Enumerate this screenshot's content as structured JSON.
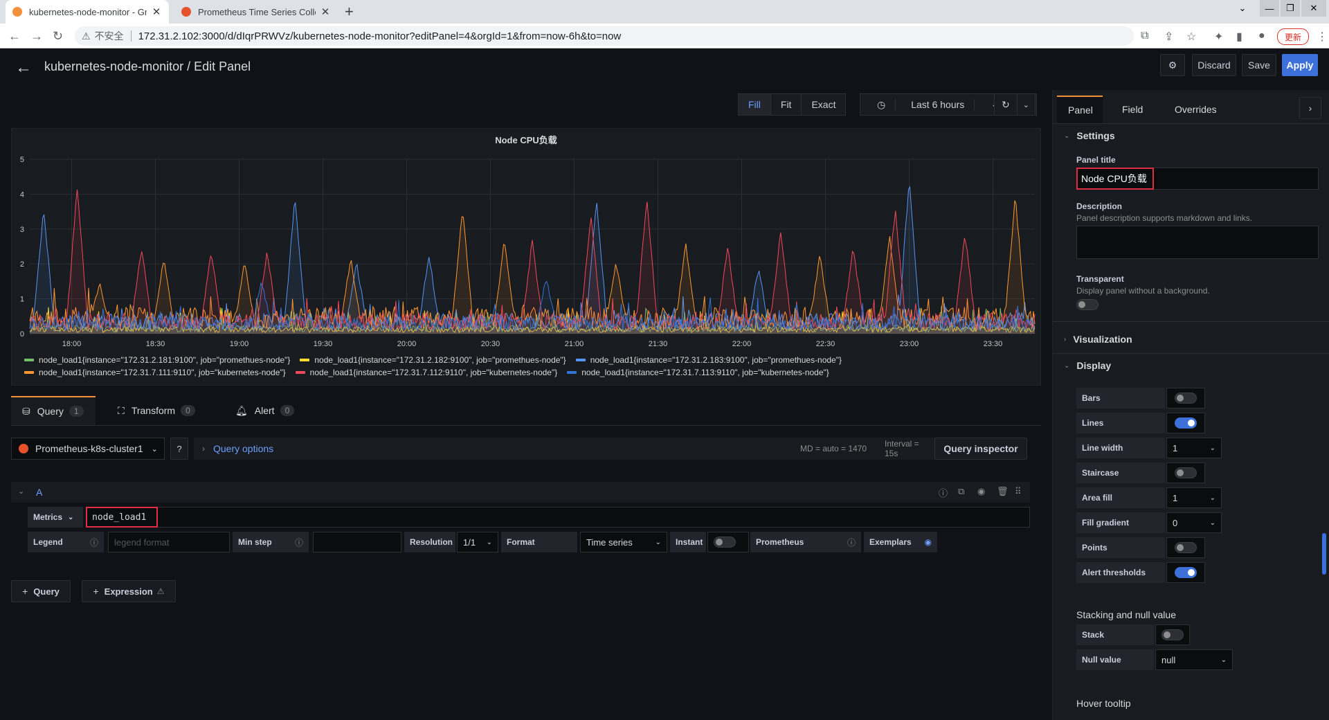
{
  "browser": {
    "tabs": [
      {
        "title": "kubernetes-node-monitor - Gr",
        "active": true
      },
      {
        "title": "Prometheus Time Series Colle",
        "active": false
      }
    ],
    "security_label": "不安全",
    "url": "172.31.2.102:3000/d/dIqrPRWVz/kubernetes-node-monitor?editPanel=4&orgId=1&from=now-6h&to=now",
    "update_label": "更新"
  },
  "header": {
    "title": "kubernetes-node-monitor / Edit Panel",
    "discard": "Discard",
    "save": "Save",
    "apply": "Apply"
  },
  "toolbar": {
    "fill": "Fill",
    "fit": "Fit",
    "exact": "Exact",
    "time_range": "Last 6 hours"
  },
  "panel": {
    "title": "Node CPU负载"
  },
  "chart_data": {
    "type": "line",
    "title": "Node CPU负载",
    "ylim": [
      0,
      5
    ],
    "yticks": [
      "0",
      "1",
      "2",
      "3",
      "4",
      "5"
    ],
    "xticks": [
      "18:00",
      "18:30",
      "19:00",
      "19:30",
      "20:00",
      "20:30",
      "21:00",
      "21:30",
      "22:00",
      "22:30",
      "23:00",
      "23:30"
    ],
    "series": [
      {
        "name": "node_load1{instance=\"172.31.2.181:9100\", job=\"promethues-node\"}",
        "color": "#73bf69",
        "base": 0.15,
        "peaks": []
      },
      {
        "name": "node_load1{instance=\"172.31.2.182:9100\", job=\"promethues-node\"}",
        "color": "#fade2a",
        "base": 0.12,
        "peaks": []
      },
      {
        "name": "node_load1{instance=\"172.31.2.183:9100\", job=\"promethues-node\"}",
        "color": "#5794f2",
        "base": 0.35,
        "peaks": [
          [
            "17:50",
            3.5
          ],
          [
            "19:20",
            3.85
          ],
          [
            "19:42",
            2.0
          ],
          [
            "20:08",
            2.2
          ],
          [
            "21:08",
            3.75
          ],
          [
            "22:06",
            1.8
          ],
          [
            "23:00",
            4.35
          ]
        ]
      },
      {
        "name": "node_load1{instance=\"172.31.7.111:9110\", job=\"kubernetes-node\"}",
        "color": "#ff9830",
        "base": 0.45,
        "peaks": [
          [
            "18:10",
            1.4
          ],
          [
            "18:33",
            2.1
          ],
          [
            "19:02",
            2.0
          ],
          [
            "19:40",
            2.1
          ],
          [
            "20:20",
            3.5
          ],
          [
            "20:35",
            2.6
          ],
          [
            "21:15",
            2.0
          ],
          [
            "21:40",
            2.5
          ],
          [
            "22:28",
            2.2
          ],
          [
            "22:53",
            2.7
          ],
          [
            "23:38",
            3.9
          ]
        ]
      },
      {
        "name": "node_load1{instance=\"172.31.7.112:9110\", job=\"kubernetes-node\"}",
        "color": "#f2495c",
        "base": 0.35,
        "peaks": [
          [
            "18:02",
            4.15
          ],
          [
            "18:25",
            2.4
          ],
          [
            "18:50",
            2.3
          ],
          [
            "19:10",
            2.3
          ],
          [
            "20:45",
            2.6
          ],
          [
            "21:06",
            3.3
          ],
          [
            "21:26",
            3.85
          ],
          [
            "21:55",
            2.4
          ],
          [
            "22:14",
            2.9
          ],
          [
            "22:40",
            2.4
          ],
          [
            "22:55",
            3.5
          ],
          [
            "23:20",
            2.8
          ]
        ]
      },
      {
        "name": "node_load1{instance=\"172.31.7.113:9110\", job=\"kubernetes-node\"}",
        "color": "#3274d9",
        "base": 0.3,
        "peaks": [
          [
            "19:08",
            1.4
          ],
          [
            "20:50",
            1.5
          ]
        ]
      }
    ]
  },
  "query_tabs": [
    {
      "label": "Query",
      "count": "1"
    },
    {
      "label": "Transform",
      "count": "0"
    },
    {
      "label": "Alert",
      "count": "0"
    }
  ],
  "query": {
    "datasource": "Prometheus-k8s-cluster1",
    "options_label": "Query options",
    "md_info": "MD = auto = 1470",
    "interval_info": "Interval = 15s",
    "inspector": "Query inspector",
    "ref_id": "A",
    "metrics_label": "Metrics",
    "metrics_value": "node_load1",
    "legend_label": "Legend",
    "legend_placeholder": "legend format",
    "minstep_label": "Min step",
    "resolution_label": "Resolution",
    "resolution_value": "1/1",
    "format_label": "Format",
    "format_value": "Time series",
    "instant_label": "Instant",
    "prometheus_label": "Prometheus",
    "exemplars_label": "Exemplars",
    "add_query": "Query",
    "add_expression": "Expression"
  },
  "sidebar": {
    "tabs": [
      "Panel",
      "Field",
      "Overrides"
    ],
    "settings": "Settings",
    "panel_title_label": "Panel title",
    "panel_title_value": "Node CPU负载",
    "description_label": "Description",
    "description_hint": "Panel description supports markdown and links.",
    "transparent_label": "Transparent",
    "transparent_hint": "Display panel without a background.",
    "visualization": "Visualization",
    "display": "Display",
    "display_rows": [
      {
        "label": "Bars",
        "kind": "toggle",
        "on": false
      },
      {
        "label": "Lines",
        "kind": "toggle",
        "on": true
      },
      {
        "label": "Line width",
        "kind": "select",
        "value": "1"
      },
      {
        "label": "Staircase",
        "kind": "toggle",
        "on": false
      },
      {
        "label": "Area fill",
        "kind": "select",
        "value": "1"
      },
      {
        "label": "Fill gradient",
        "kind": "select",
        "value": "0"
      },
      {
        "label": "Points",
        "kind": "toggle",
        "on": false
      },
      {
        "label": "Alert thresholds",
        "kind": "toggle",
        "on": true
      }
    ],
    "stacking": "Stacking and null value",
    "stack_label": "Stack",
    "null_value_label": "Null value",
    "null_value": "null",
    "hover_tooltip": "Hover tooltip"
  }
}
